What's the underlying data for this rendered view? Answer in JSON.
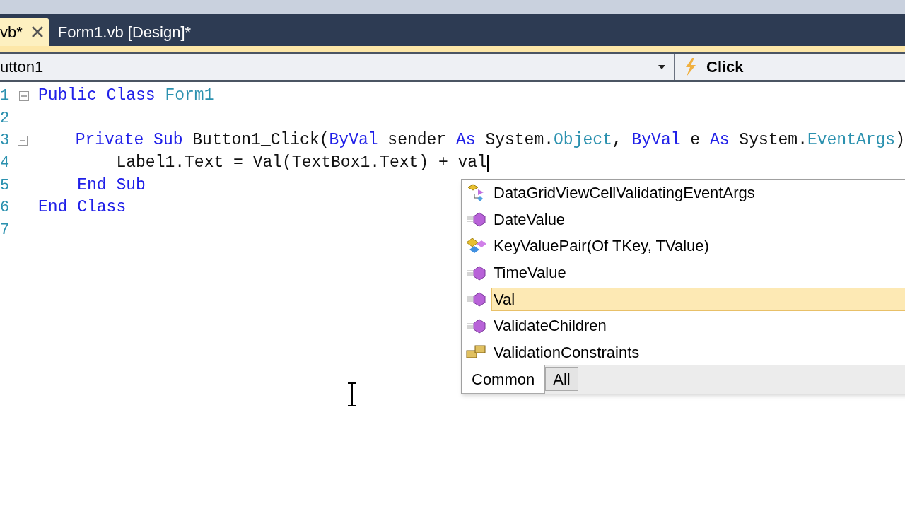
{
  "tabs": [
    {
      "label": "vb*",
      "selected": true,
      "closable": true
    },
    {
      "label": "Form1.vb [Design]*",
      "selected": false,
      "closable": false
    }
  ],
  "member_bar": {
    "object": "utton1",
    "event": "Click"
  },
  "code": {
    "lines": [
      {
        "number": "1",
        "fold": true,
        "tokens": [
          {
            "kind": "keyword",
            "text": "Public Class "
          },
          {
            "kind": "type",
            "text": "Form1"
          }
        ]
      },
      {
        "number": "2",
        "fold": false
      },
      {
        "number": "3",
        "fold": true,
        "tokens": [
          {
            "kind": "keyword",
            "text": "    Private Sub "
          },
          {
            "kind": "plain",
            "text": "Button1_Click("
          },
          {
            "kind": "keyword",
            "text": "ByVal "
          },
          {
            "kind": "plain",
            "text": "sender "
          },
          {
            "kind": "keyword",
            "text": "As "
          },
          {
            "kind": "plain",
            "text": "System."
          },
          {
            "kind": "type",
            "text": "Object"
          },
          {
            "kind": "plain",
            "text": ", "
          },
          {
            "kind": "keyword",
            "text": "ByVal "
          },
          {
            "kind": "plain",
            "text": "e "
          },
          {
            "kind": "keyword",
            "text": "As "
          },
          {
            "kind": "plain",
            "text": "System."
          },
          {
            "kind": "type",
            "text": "EventArgs"
          },
          {
            "kind": "plain",
            "text": ")"
          }
        ]
      },
      {
        "number": "4",
        "fold": false,
        "caret": true,
        "tokens": [
          {
            "kind": "plain",
            "text": "        Label1.Text = Val(TextBox1.Text) + val"
          }
        ]
      },
      {
        "number": "5",
        "fold": false,
        "tokens": [
          {
            "kind": "keyword",
            "text": "    End Sub"
          }
        ]
      },
      {
        "number": "6",
        "fold": false,
        "tokens": [
          {
            "kind": "keyword",
            "text": "End Class"
          }
        ]
      },
      {
        "number": "7",
        "fold": false
      }
    ]
  },
  "completion": {
    "items": [
      {
        "kind": "class",
        "label": "DataGridViewCellValidatingEventArgs",
        "selected": false
      },
      {
        "kind": "method",
        "label": "DateValue",
        "selected": false
      },
      {
        "kind": "struct",
        "label": "KeyValuePair(Of TKey, TValue)",
        "selected": false
      },
      {
        "kind": "method",
        "label": "TimeValue",
        "selected": false
      },
      {
        "kind": "method",
        "label": "Val",
        "selected": true
      },
      {
        "kind": "method",
        "label": "ValidateChildren",
        "selected": false
      },
      {
        "kind": "namespace",
        "label": "ValidationConstraints",
        "selected": false
      }
    ],
    "tabs": [
      {
        "label": "Common",
        "selected": true
      },
      {
        "label": "All",
        "selected": false
      }
    ]
  }
}
